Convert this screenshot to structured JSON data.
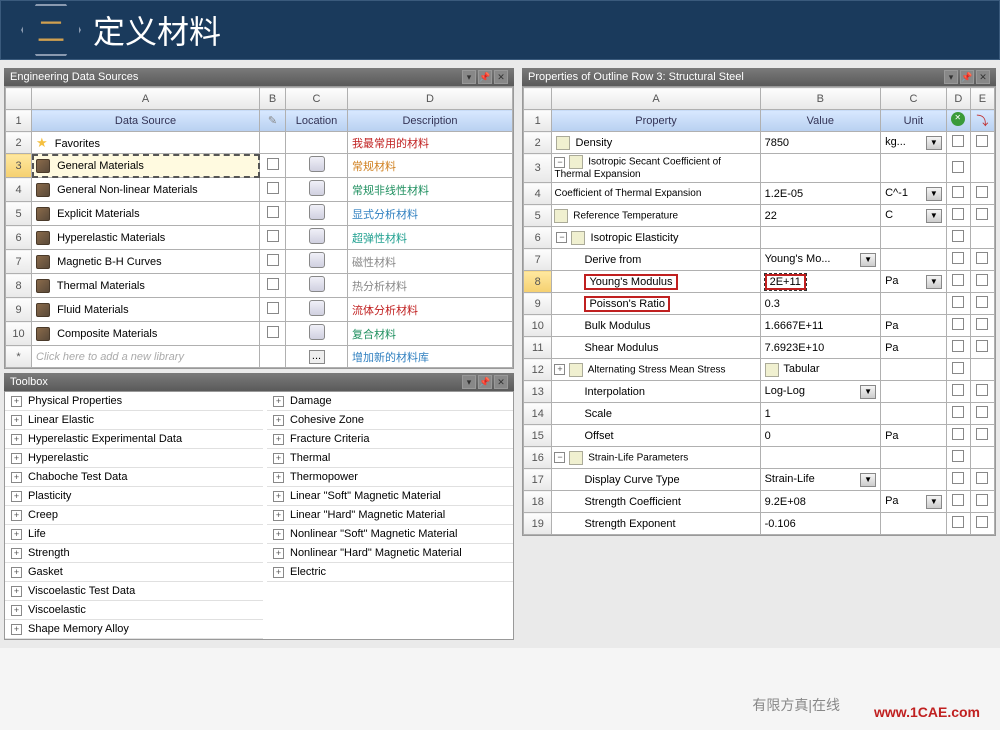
{
  "title": {
    "badge": "二",
    "text": "定义材料"
  },
  "panels": {
    "dataSources": {
      "title": "Engineering Data Sources",
      "cols": [
        "A",
        "B",
        "C",
        "D"
      ],
      "headers": {
        "a": "Data Source",
        "c": "Location",
        "d": "Description"
      },
      "rows": [
        {
          "n": "2",
          "icon": "star",
          "name": "Favorites",
          "desc": "我最常用的材料",
          "descClass": "desc-red"
        },
        {
          "n": "3",
          "icon": "book",
          "name": "General Materials",
          "desc": "常规材料",
          "descClass": "desc-orange",
          "selected": true
        },
        {
          "n": "4",
          "icon": "book",
          "name": "General Non-linear Materials",
          "desc": "常规非线性材料",
          "descClass": "desc-green"
        },
        {
          "n": "5",
          "icon": "book",
          "name": "Explicit Materials",
          "desc": "显式分析材料",
          "descClass": "desc-blue"
        },
        {
          "n": "6",
          "icon": "book",
          "name": "Hyperelastic Materials",
          "desc": "超弹性材料",
          "descClass": "desc-teal"
        },
        {
          "n": "7",
          "icon": "book",
          "name": "Magnetic B-H Curves",
          "desc": "磁性材料",
          "descClass": "desc-gray"
        },
        {
          "n": "8",
          "icon": "book",
          "name": "Thermal Materials",
          "desc": "热分析材料",
          "descClass": "desc-gray"
        },
        {
          "n": "9",
          "icon": "book",
          "name": "Fluid Materials",
          "desc": "流体分析材料",
          "descClass": "desc-red"
        },
        {
          "n": "10",
          "icon": "book",
          "name": "Composite Materials",
          "desc": "复合材料",
          "descClass": "desc-green"
        }
      ],
      "placeholder": "Click here to add a new library",
      "placeholderDesc": "增加新的材料库"
    },
    "toolbox": {
      "title": "Toolbox",
      "col1": [
        "Physical Properties",
        "Linear Elastic",
        "Hyperelastic Experimental Data",
        "Hyperelastic",
        "Chaboche Test Data",
        "Plasticity",
        "Creep",
        "Life",
        "Strength",
        "Gasket",
        "Viscoelastic Test Data",
        "Viscoelastic",
        "Shape Memory Alloy"
      ],
      "col2": [
        "Damage",
        "Cohesive Zone",
        "Fracture Criteria",
        "Thermal",
        "Thermopower",
        "Linear \"Soft\" Magnetic Material",
        "Linear \"Hard\" Magnetic Material",
        "Nonlinear \"Soft\" Magnetic Material",
        "Nonlinear \"Hard\" Magnetic Material",
        "Electric"
      ]
    },
    "properties": {
      "title": "Properties of Outline Row 3: Structural Steel",
      "cols": [
        "A",
        "B",
        "C",
        "D",
        "E"
      ],
      "headers": {
        "a": "Property",
        "b": "Value",
        "c": "Unit"
      },
      "rows": [
        {
          "n": "2",
          "prop": "Density",
          "val": "7850",
          "unit": "kg...",
          "unitDrop": true,
          "icon": true
        },
        {
          "n": "3",
          "prop": "Isotropic Secant Coefficient of Thermal Expansion",
          "collapse": "−",
          "icon": true,
          "multiline": true
        },
        {
          "n": "4",
          "prop": "Coefficient of Thermal Expansion",
          "val": "1.2E-05",
          "unit": "C^-1",
          "unitDrop": true,
          "indent": 2,
          "multiline": true
        },
        {
          "n": "5",
          "prop": "Reference Temperature",
          "val": "22",
          "unit": "C",
          "unitDrop": true,
          "indent": 2,
          "icon": true,
          "multiline": true
        },
        {
          "n": "6",
          "prop": "Isotropic Elasticity",
          "collapse": "−",
          "icon": true
        },
        {
          "n": "7",
          "prop": "Derive from",
          "val": "Young's Mo...",
          "valDrop": true,
          "indent": 2
        },
        {
          "n": "8",
          "prop": "Young's Modulus",
          "val": "2E+11",
          "unit": "Pa",
          "unitDrop": true,
          "indent": 2,
          "highlight": true
        },
        {
          "n": "9",
          "prop": "Poisson's Ratio",
          "val": "0.3",
          "indent": 2,
          "propBox": true
        },
        {
          "n": "10",
          "prop": "Bulk Modulus",
          "val": "1.6667E+11",
          "unit": "Pa",
          "indent": 2
        },
        {
          "n": "11",
          "prop": "Shear Modulus",
          "val": "7.6923E+10",
          "unit": "Pa",
          "indent": 2
        },
        {
          "n": "12",
          "prop": "Alternating Stress Mean Stress",
          "val": "Tabular",
          "valIcon": true,
          "collapse": "+",
          "icon": true,
          "multiline": true
        },
        {
          "n": "13",
          "prop": "Interpolation",
          "val": "Log-Log",
          "valDrop": true,
          "indent": 2
        },
        {
          "n": "14",
          "prop": "Scale",
          "val": "1",
          "indent": 2
        },
        {
          "n": "15",
          "prop": "Offset",
          "val": "0",
          "unit": "Pa",
          "indent": 2
        },
        {
          "n": "16",
          "prop": "Strain-Life Parameters",
          "collapse": "−",
          "icon": true,
          "multiline": true
        },
        {
          "n": "17",
          "prop": "Display Curve Type",
          "val": "Strain-Life",
          "valDrop": true,
          "indent": 2
        },
        {
          "n": "18",
          "prop": "Strength Coefficient",
          "val": "9.2E+08",
          "unit": "Pa",
          "unitDrop": true,
          "indent": 2
        },
        {
          "n": "19",
          "prop": "Strength Exponent",
          "val": "-0.106",
          "indent": 2
        }
      ]
    }
  },
  "watermark": {
    "site": "www.1CAE.com",
    "brand": "有限方真|在线"
  }
}
